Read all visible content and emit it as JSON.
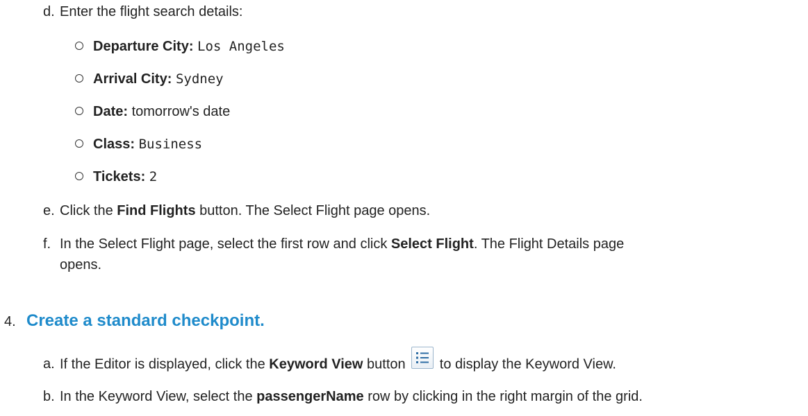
{
  "step_d": {
    "letter": "d.",
    "text": "Enter the flight search details:",
    "details": [
      {
        "label": "Departure City:",
        "value": "Los Angeles"
      },
      {
        "label": "Arrival City:",
        "value": "Sydney"
      },
      {
        "label": "Date:",
        "value": "tomorrow's date"
      },
      {
        "label": "Class:",
        "value": "Business"
      },
      {
        "label": "Tickets:",
        "value": "2"
      }
    ]
  },
  "step_e": {
    "letter": "e.",
    "pre": "Click the ",
    "bold": "Find Flights",
    "post": " button. The Select Flight page opens."
  },
  "step_f": {
    "letter": "f.",
    "pre": "In the Select Flight page, select the first row and click ",
    "bold": "Select Flight",
    "post": ". The Flight Details page",
    "continuation": "opens."
  },
  "section4": {
    "number": "4.",
    "title": "Create a standard checkpoint."
  },
  "step_a": {
    "letter": "a.",
    "pre": "If the Editor is displayed, click the ",
    "bold": "Keyword View",
    "mid": " button ",
    "icon": "keyword-view-icon",
    "post": " to display the Keyword View."
  },
  "step_b": {
    "letter": "b.",
    "pre": "In the Keyword View, select the ",
    "bold": "passengerName",
    "post": " row by clicking in the right margin of the grid."
  }
}
